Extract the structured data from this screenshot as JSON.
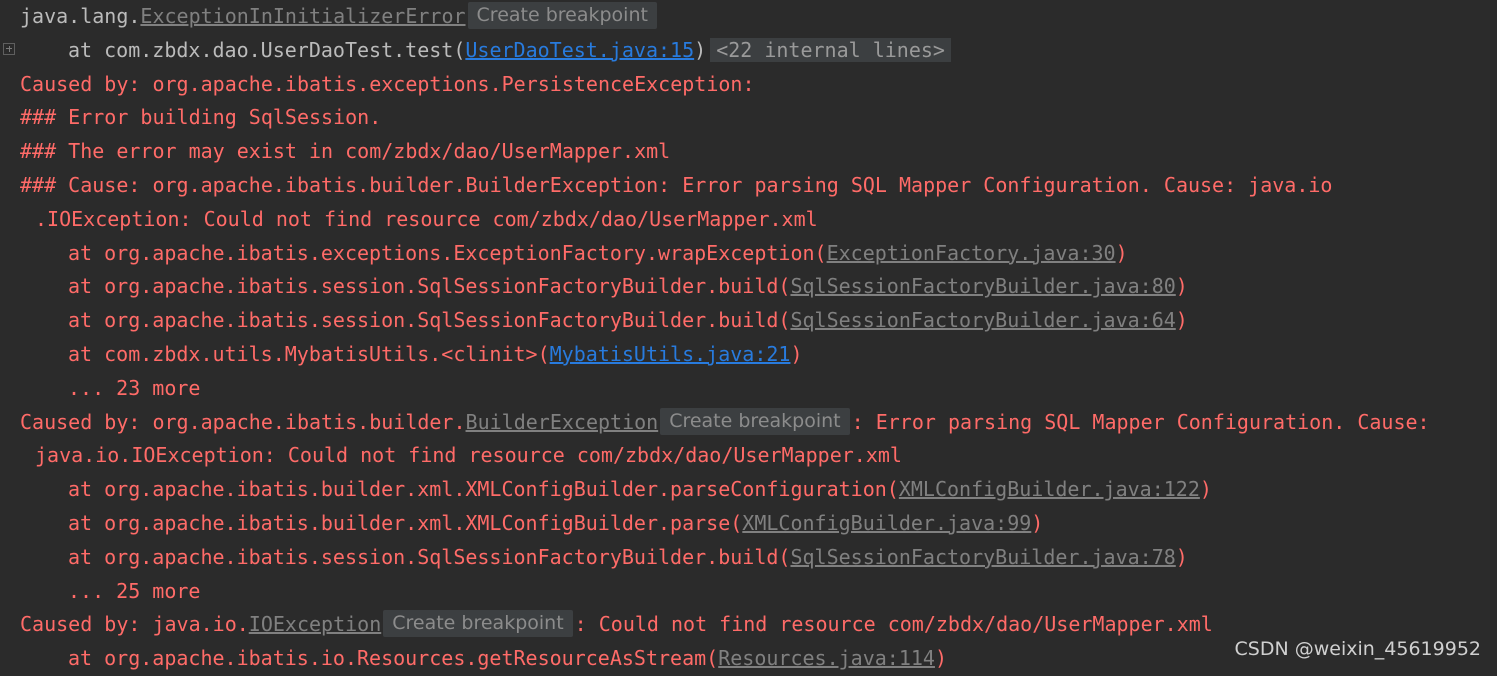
{
  "console": {
    "l1": {
      "pre": "java.lang.",
      "cls": "ExceptionInInitializerError",
      "chip": "Create breakpoint"
    },
    "l2": {
      "pre": "at com.zbdx.dao.UserDaoTest.test(",
      "link": "UserDaoTest.java:15",
      "post": ")",
      "folded": "<22 internal lines>"
    },
    "l3": "Caused by: org.apache.ibatis.exceptions.PersistenceException: ",
    "l4": "### Error building SqlSession.",
    "l5": "### The error may exist in com/zbdx/dao/UserMapper.xml",
    "l6": "### Cause: org.apache.ibatis.builder.BuilderException: Error parsing SQL Mapper Configuration. Cause: java.io",
    "l7": ".IOException: Could not find resource com/zbdx/dao/UserMapper.xml",
    "l8": {
      "pre": "at org.apache.ibatis.exceptions.ExceptionFactory.wrapException(",
      "link": "ExceptionFactory.java:30",
      "post": ")"
    },
    "l9": {
      "pre": "at org.apache.ibatis.session.SqlSessionFactoryBuilder.build(",
      "link": "SqlSessionFactoryBuilder.java:80",
      "post": ")"
    },
    "l10": {
      "pre": "at org.apache.ibatis.session.SqlSessionFactoryBuilder.build(",
      "link": "SqlSessionFactoryBuilder.java:64",
      "post": ")"
    },
    "l11": {
      "pre": "at com.zbdx.utils.MybatisUtils.<clinit>(",
      "link": "MybatisUtils.java:21",
      "post": ")"
    },
    "l12": "... 23 more",
    "l13": {
      "pre": "Caused by: org.apache.ibatis.builder.",
      "cls": "BuilderException",
      "chip": "Create breakpoint",
      "post": ": Error parsing SQL Mapper Configuration. Cause:"
    },
    "l14": "java.io.IOException: Could not find resource com/zbdx/dao/UserMapper.xml",
    "l15": {
      "pre": "at org.apache.ibatis.builder.xml.XMLConfigBuilder.parseConfiguration(",
      "link": "XMLConfigBuilder.java:122",
      "post": ")"
    },
    "l16": {
      "pre": "at org.apache.ibatis.builder.xml.XMLConfigBuilder.parse(",
      "link": "XMLConfigBuilder.java:99",
      "post": ")"
    },
    "l17": {
      "pre": "at org.apache.ibatis.session.SqlSessionFactoryBuilder.build(",
      "link": "SqlSessionFactoryBuilder.java:78",
      "post": ")"
    },
    "l18": "... 25 more",
    "l19": {
      "pre": "Caused by: java.io.",
      "cls": "IOException",
      "chip": "Create breakpoint",
      "post": ": Could not find resource com/zbdx/dao/UserMapper.xml"
    },
    "l20": {
      "pre": "at org.apache.ibatis.io.Resources.getResourceAsStream(",
      "link": "Resources.java:114",
      "post": ")"
    }
  },
  "watermark": "CSDN @weixin_45619952",
  "colors": {
    "background": "#2b2b2b",
    "error_text": "#ff6b68",
    "plain_text": "#bbbbbb",
    "project_link": "#287bde",
    "library_link": "#808080"
  }
}
